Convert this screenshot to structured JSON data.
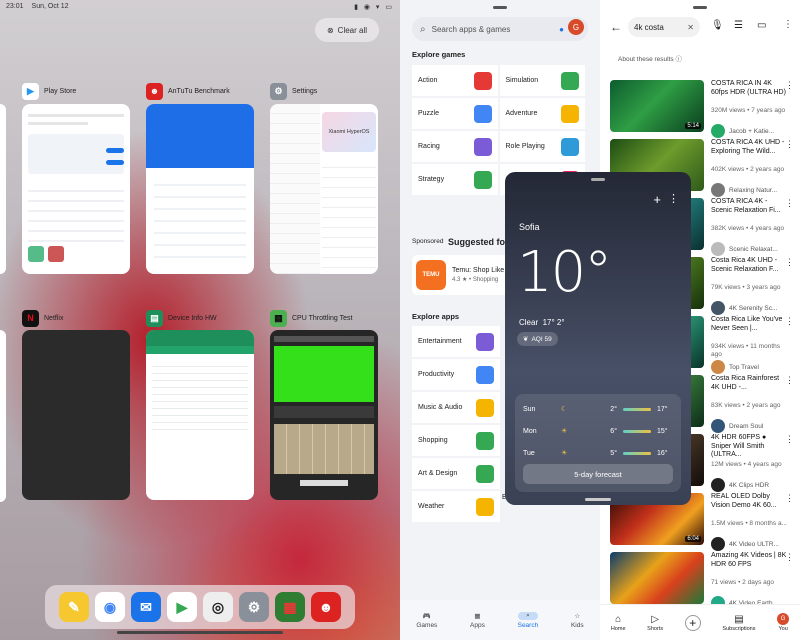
{
  "status_bar": {
    "time": "23:01",
    "date": "Sun, Oct 12"
  },
  "recents": {
    "clear_all_label": "Clear all",
    "cards": [
      {
        "app": "Play Store"
      },
      {
        "app": "AnTuTu Benchmark"
      },
      {
        "app": "Settings",
        "brand_text": "Xiaomi HyperOS"
      },
      {
        "app": "Netflix"
      },
      {
        "app": "Device Info HW"
      },
      {
        "app": "CPU Throttling Test"
      }
    ],
    "dock": [
      "notes-icon",
      "chrome-icon",
      "messages-icon",
      "play-store-icon",
      "camera-icon",
      "settings-icon",
      "cpu-throttling-icon",
      "antutu-icon"
    ]
  },
  "play_store": {
    "search_placeholder": "Search apps & games",
    "avatar_letter": "G",
    "explore_games_title": "Explore games",
    "games": [
      {
        "label": "Action",
        "color": "#e53935"
      },
      {
        "label": "Simulation",
        "color": "#34a853"
      },
      {
        "label": "Puzzle",
        "color": "#4285f4"
      },
      {
        "label": "Adventure",
        "color": "#f4b400"
      },
      {
        "label": "Racing",
        "color": "#7b5cd6"
      },
      {
        "label": "Role Playing",
        "color": "#2e9bd8"
      },
      {
        "label": "Strategy",
        "color": "#34a853"
      },
      {
        "label": "Card",
        "color": "#e91e63"
      }
    ],
    "sponsored_label": "Sponsored",
    "suggested_title": "Suggested for",
    "temu": {
      "name": "Temu: Shop Like",
      "rating": "4.3",
      "category": "Shopping",
      "icon_text": "TEMU"
    },
    "explore_apps_title": "Explore apps",
    "apps": [
      {
        "label": "Entertainment",
        "color": "#7b5cd6"
      },
      {
        "label": "Productivity",
        "color": "#4285f4"
      },
      {
        "label": "Music & Audio",
        "color": "#f4b400"
      },
      {
        "label": "Shopping",
        "color": "#34a853"
      },
      {
        "label": "Art & Design",
        "color": "#34a853"
      },
      {
        "label": "Weather",
        "color": "#f4b400"
      }
    ],
    "beauty_label": "Beauty",
    "nav": [
      "Games",
      "Apps",
      "Search",
      "Kids"
    ]
  },
  "weather": {
    "city": "Sofia",
    "temperature": "10°",
    "condition": "Clear",
    "high_low": "17° 2°",
    "aqi": "AQI 59",
    "forecast": [
      {
        "day": "Sun",
        "icon": "moon-icon",
        "low": "2°",
        "high": "17°"
      },
      {
        "day": "Mon",
        "icon": "sun-icon",
        "low": "6°",
        "high": "15°"
      },
      {
        "day": "Tue",
        "icon": "sun-icon",
        "low": "5°",
        "high": "16°"
      }
    ],
    "button_label": "5-day forecast"
  },
  "youtube": {
    "query": "4k costa",
    "about_results": "About these results",
    "videos": [
      {
        "title": "COSTA RICA IN 4K 60fps HDR (ULTRA HD)",
        "meta": "320M views • 7 years ago",
        "channel": "Jacob + Katie...",
        "duration": "5:14",
        "thumb": "linear-gradient(135deg,#0d5c2f,#2f9e44 45%,#0a3d1f)",
        "avatar": "#2a6"
      },
      {
        "title": "COSTA RICA 4K UHD - Exploring The Wild...",
        "meta": "402K views • 2 years ago",
        "channel": "Relaxing Natur...",
        "duration": "",
        "thumb": "linear-gradient(135deg,#1c4d14,#6e9b2c 50%,#2e5a1a)",
        "avatar": "#777"
      },
      {
        "title": "COSTA RICA 4K - Scenic Relaxation Fi...",
        "meta": "382K views • 4 years ago",
        "channel": "Scenic Relaxat...",
        "duration": "",
        "thumb": "linear-gradient(135deg,#0d4040,#238080 50%,#0b2f2f)",
        "avatar": "#bbb"
      },
      {
        "title": "Costa Rica 4K UHD - Scenic Relaxation F...",
        "meta": "79K views • 3 years ago",
        "channel": "4K Serenity Sc...",
        "duration": "",
        "thumb": "linear-gradient(135deg,#1a3e10,#4e7d20 50%,#16300c)",
        "avatar": "#456"
      },
      {
        "title": "Costa Rica Like You've Never Seen |...",
        "meta": "934K views • 11 months ago",
        "channel": "Top Travel",
        "duration": "",
        "thumb": "linear-gradient(135deg,#125046,#2c9b79 50%,#0a3329)",
        "avatar": "#c84"
      },
      {
        "title": "Costa Rica Rainforest 4K UHD -...",
        "meta": "83K views • 2 years ago",
        "channel": "Dream Soul",
        "duration": "",
        "thumb": "linear-gradient(135deg,#0f3d24,#3a7d3c 50%,#0c2d1a)",
        "avatar": "#357"
      },
      {
        "title": "4K HDR 60FPS ● Sniper Will Smith (ULTRA...",
        "meta": "12M views • 4 years ago",
        "channel": "4K Clips HDR",
        "duration": "",
        "thumb": "linear-gradient(135deg,#110c08,#4c3a2a 50%,#110c08)",
        "avatar": "#222"
      },
      {
        "title": "REAL OLED Dolby Vision Demo 4K 60...",
        "meta": "1.5M views • 8 months a...",
        "channel": "4K Video ULTR...",
        "duration": "6:04",
        "thumb": "linear-gradient(135deg,#2a0a06,#c2301b 40%,#f0a020 70%,#2a0a06)",
        "avatar": "#222"
      },
      {
        "title": "Amazing 4K Videos | 8K HDR 60 FPS",
        "meta": "71 views • 2 days ago",
        "channel": "4K Video Earth",
        "duration": "",
        "thumb": "linear-gradient(135deg,#0b3c6a,#e8a21a 40%,#d8401c 65%,#1b7a3a)",
        "avatar": "#2a8"
      }
    ],
    "nav": [
      "Home",
      "Shorts",
      "Subscriptions",
      "You"
    ]
  }
}
